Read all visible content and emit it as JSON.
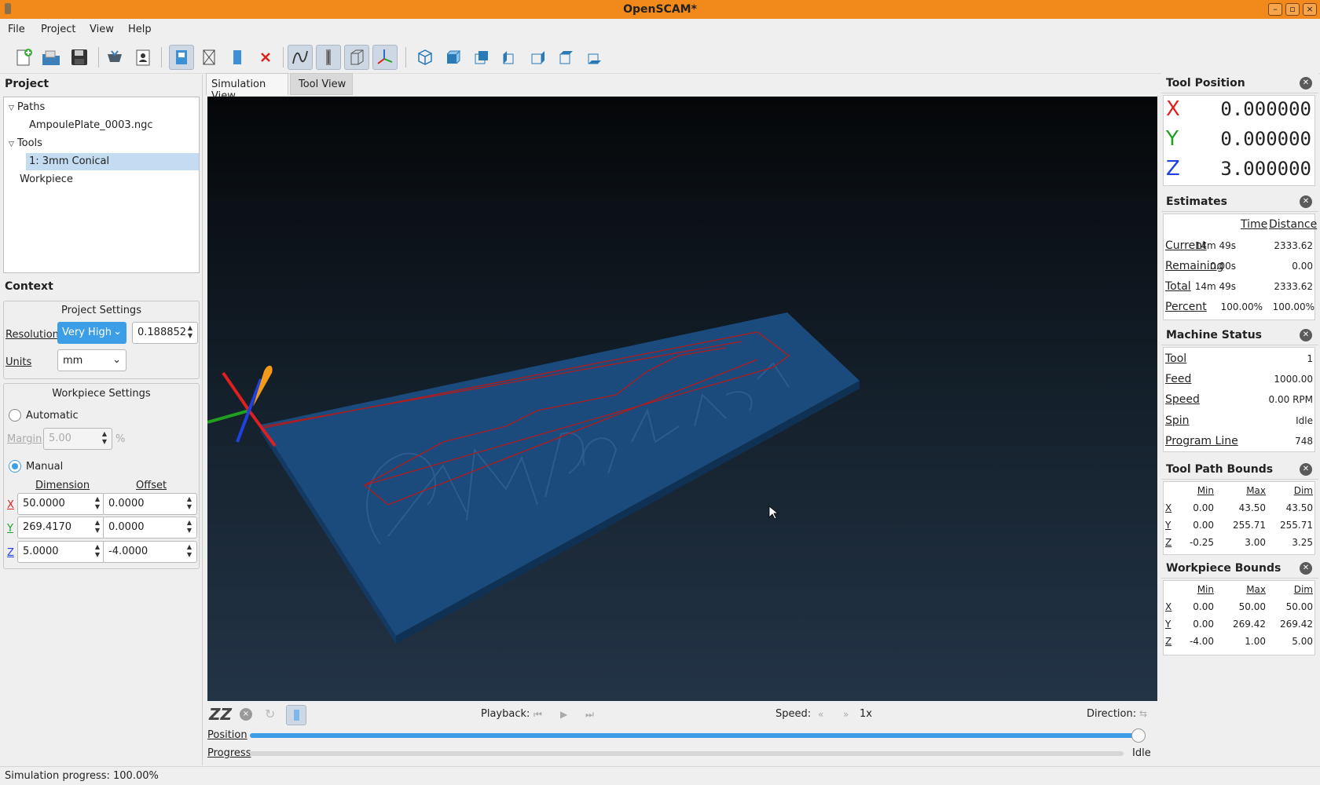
{
  "window": {
    "title": "OpenSCAM*",
    "min": "–",
    "max": "▫",
    "close": "×"
  },
  "menu": [
    "File",
    "Project",
    "View",
    "Help"
  ],
  "tabs": [
    "Simulation View",
    "Tool View"
  ],
  "project": {
    "title": "Project",
    "tree": {
      "paths": "Paths",
      "file": "AmpoulePlate_0003.ngc",
      "tools": "Tools",
      "tool": "1: 3mm Conical",
      "workpiece": "Workpiece"
    }
  },
  "context": {
    "title": "Context",
    "project_settings": "Project Settings",
    "resolution_label": "Resolution",
    "resolution_mode": "Very High",
    "resolution_value": "0.188852",
    "units_label": "Units",
    "units_value": "mm",
    "workpiece_settings": "Workpiece Settings",
    "automatic": "Automatic",
    "margin_label": "Margin",
    "margin_value": "5.00",
    "margin_unit": "%",
    "manual": "Manual",
    "dimension": "Dimension",
    "offset": "Offset",
    "rows": [
      {
        "axis": "X",
        "dim": "50.0000",
        "off": "0.0000"
      },
      {
        "axis": "Y",
        "dim": "269.4170",
        "off": "0.0000"
      },
      {
        "axis": "Z",
        "dim": "5.0000",
        "off": "-4.0000"
      }
    ]
  },
  "tool_position": {
    "title": "Tool Position",
    "x": "0.000000",
    "y": "0.000000",
    "z": "3.000000",
    "xl": "X",
    "yl": "Y",
    "zl": "Z"
  },
  "estimates": {
    "title": "Estimates",
    "h_time": "Time",
    "h_dist": "Distance",
    "rows": [
      {
        "label": "Current",
        "time": "14m 49s",
        "dist": "2333.62"
      },
      {
        "label": "Remaining",
        "time": "0.00s",
        "dist": "0.00"
      },
      {
        "label": "Total",
        "time": "14m 49s",
        "dist": "2333.62"
      },
      {
        "label": "Percent",
        "time": "100.00%",
        "dist": "100.00%"
      }
    ]
  },
  "machine_status": {
    "title": "Machine Status",
    "rows": [
      {
        "label": "Tool",
        "value": "1"
      },
      {
        "label": "Feed",
        "value": "1000.00"
      },
      {
        "label": "Speed",
        "value": "0.00 RPM"
      },
      {
        "label": "Spin",
        "value": "Idle"
      },
      {
        "label": "Program Line",
        "value": "748"
      }
    ]
  },
  "tool_path_bounds": {
    "title": "Tool Path Bounds",
    "h_min": "Min",
    "h_max": "Max",
    "h_dim": "Dim",
    "rows": [
      {
        "a": "X",
        "min": "0.00",
        "max": "43.50",
        "dim": "43.50"
      },
      {
        "a": "Y",
        "min": "0.00",
        "max": "255.71",
        "dim": "255.71"
      },
      {
        "a": "Z",
        "min": "-0.25",
        "max": "3.00",
        "dim": "3.25"
      }
    ]
  },
  "workpiece_bounds": {
    "title": "Workpiece Bounds",
    "h_min": "Min",
    "h_max": "Max",
    "h_dim": "Dim",
    "rows": [
      {
        "a": "X",
        "min": "0.00",
        "max": "50.00",
        "dim": "50.00"
      },
      {
        "a": "Y",
        "min": "0.00",
        "max": "269.42",
        "dim": "269.42"
      },
      {
        "a": "Z",
        "min": "-4.00",
        "max": "1.00",
        "dim": "5.00"
      }
    ]
  },
  "controls": {
    "zz": "ZZ",
    "playback": "Playback:",
    "speed": "Speed:",
    "speed_value": "1x",
    "direction": "Direction:",
    "position": "Position",
    "progress": "Progress",
    "state": "Idle",
    "position_fraction": 1.0,
    "progress_fraction": 0.0
  },
  "status": "Simulation progress: 100.00%",
  "colors": {
    "accent": "#3c9ee6",
    "titlebar": "#f28a1b",
    "axis_x": "#e02020",
    "axis_y": "#20a020",
    "axis_z": "#2040e0",
    "plate": "#1b4a7c"
  }
}
